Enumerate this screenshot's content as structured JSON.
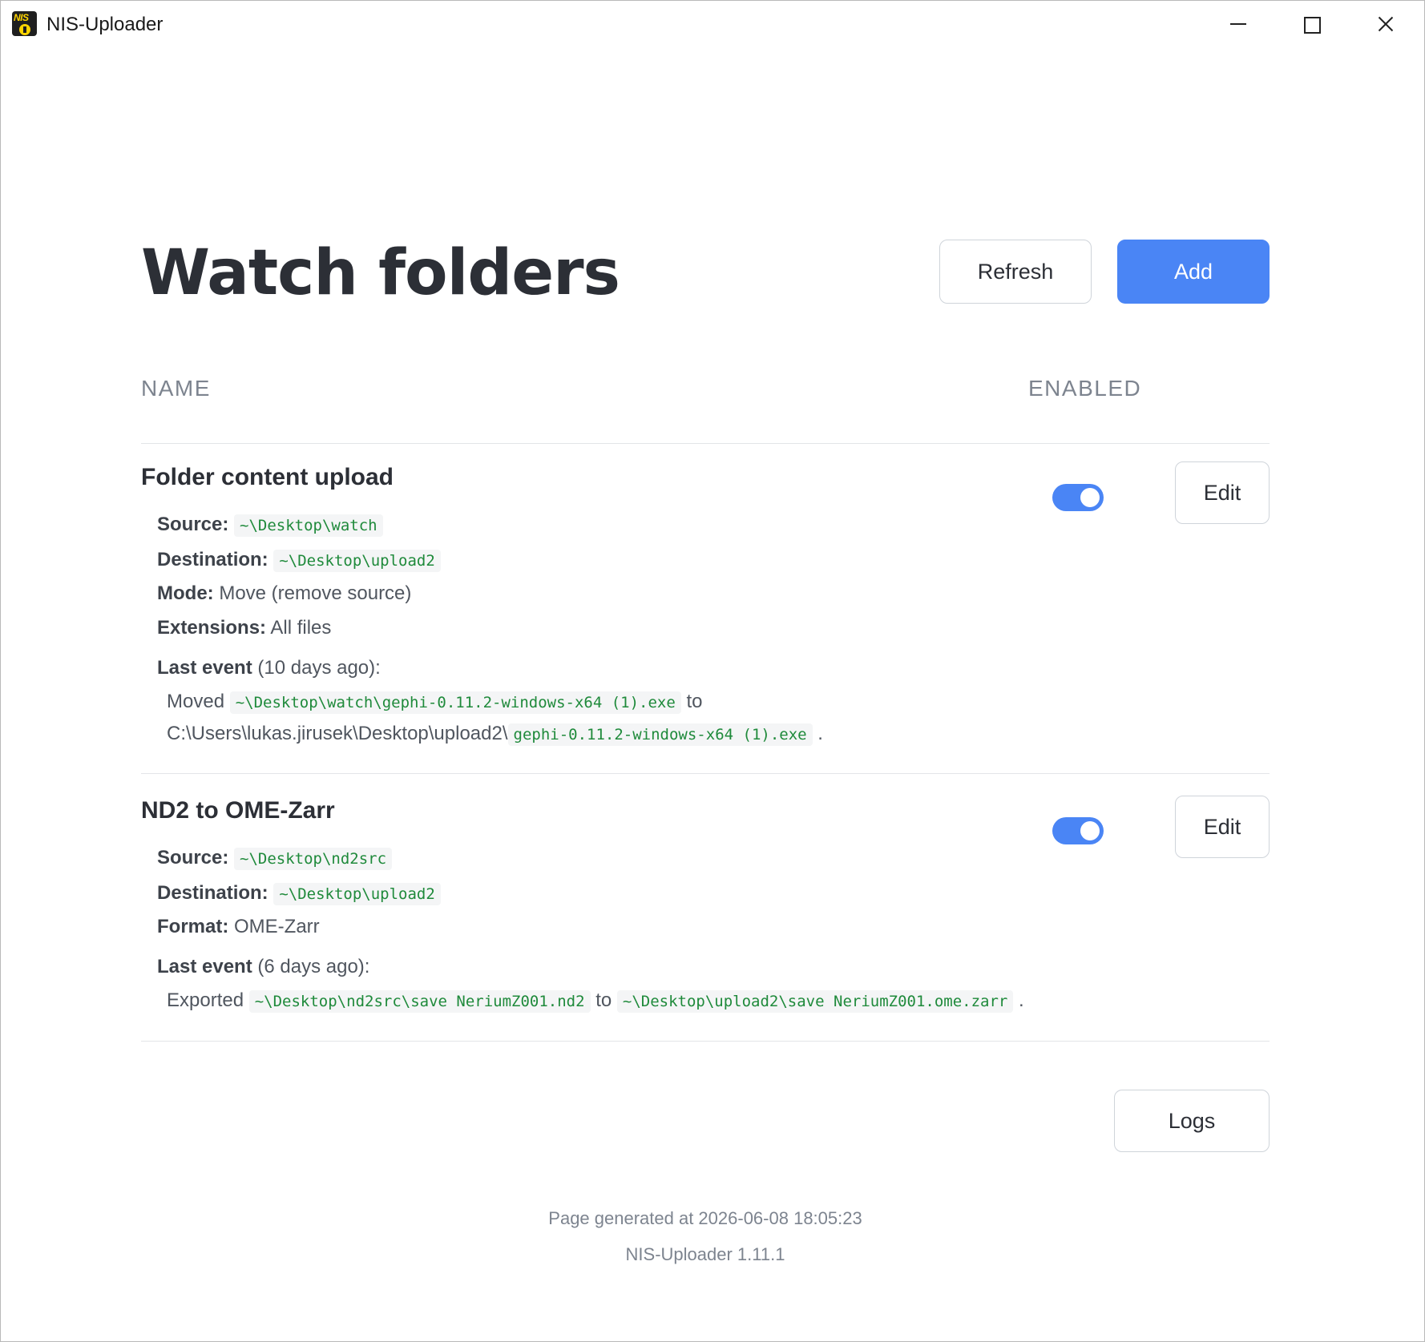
{
  "window": {
    "title": "NIS-Uploader",
    "icon": "nis-uploader-logo",
    "logo_text": "NIS"
  },
  "header": {
    "title": "Watch folders",
    "refresh_label": "Refresh",
    "add_label": "Add"
  },
  "table": {
    "col_name": "NAME",
    "col_enabled": "ENABLED"
  },
  "entries": [
    {
      "name": "Folder content upload",
      "enabled": true,
      "edit_label": "Edit",
      "source_label": "Source:",
      "source": "~\\Desktop\\watch",
      "destination_label": "Destination:",
      "destination": "~\\Desktop\\upload2",
      "mode_label": "Mode:",
      "mode": "Move (remove source)",
      "extensions_label": "Extensions:",
      "extensions": "All files",
      "last_event_label": "Last event",
      "last_event_age": "(10 days ago):",
      "event_verb": "Moved",
      "event_from": "~\\Desktop\\watch\\gephi-0.11.2-windows-x64 (1).exe",
      "event_to_word": "to",
      "event_to_prefix": "C:\\Users\\lukas.jirusek\\Desktop\\upload2\\",
      "event_to": "gephi-0.11.2-windows-x64 (1).exe",
      "event_end": "."
    },
    {
      "name": "ND2 to OME-Zarr",
      "enabled": true,
      "edit_label": "Edit",
      "source_label": "Source:",
      "source": "~\\Desktop\\nd2src",
      "destination_label": "Destination:",
      "destination": "~\\Desktop\\upload2",
      "format_label": "Format:",
      "format": "OME-Zarr",
      "last_event_label": "Last event",
      "last_event_age": "(6 days ago):",
      "event_verb": "Exported",
      "event_from": "~\\Desktop\\nd2src\\save NeriumZ001.nd2",
      "event_to_word": "to",
      "event_to": "~\\Desktop\\upload2\\save NeriumZ001.ome.zarr",
      "event_end": "."
    }
  ],
  "logs_label": "Logs",
  "footer": {
    "generated": "Page generated at 2026-06-08 18:05:23",
    "version": "NIS-Uploader 1.11.1"
  },
  "colors": {
    "accent": "#4a85f5",
    "code": "#1f8a3b",
    "muted": "#7d848f"
  }
}
